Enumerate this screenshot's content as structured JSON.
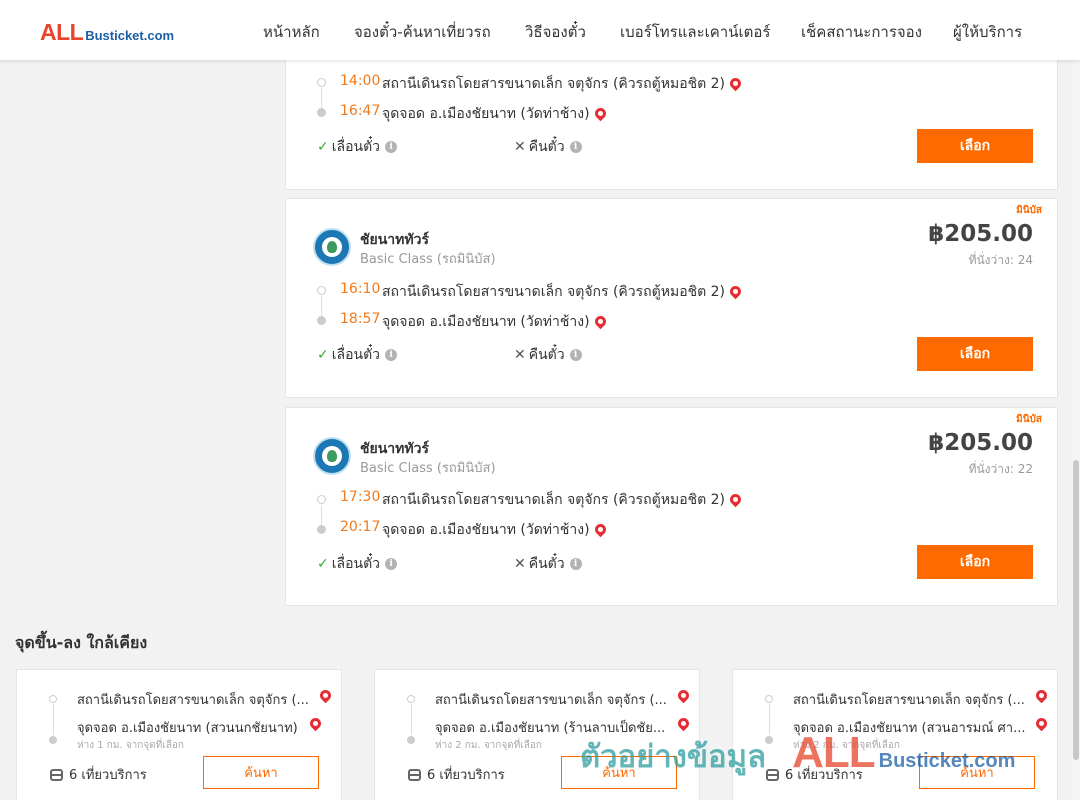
{
  "header": {
    "logo_all": "ALL",
    "logo_rest": "Busticket.com",
    "nav": [
      {
        "label": "หน้าหลัก"
      },
      {
        "label": "จองตั๋ว-ค้นหาเที่ยวรถ"
      },
      {
        "label": "วิธีจองตั๋ว"
      },
      {
        "label": "เบอร์โทรและเคาน์เตอร์"
      },
      {
        "label": "เช็คสถานะการจอง"
      },
      {
        "label": "ผู้ให้บริการ"
      }
    ]
  },
  "trips": [
    {
      "depart_time": "14:00",
      "depart_stop": "สถานีเดินรถโดยสารขนาดเล็ก จตุจักร (คิวรถตู้หมอชิต 2)",
      "arrive_time": "16:47",
      "arrive_stop": "จุดจอด อ.เมืองชัยนาท (วัดท่าช้าง)",
      "change_label": "เลื่อนตั๋ว",
      "refund_label": "คืนตั๋ว",
      "select_label": "เลือก"
    },
    {
      "badge": "มินิบัส",
      "operator": "ชัยนาททัวร์",
      "bus_class": "Basic Class (รถมินิบัส)",
      "price": "฿205.00",
      "seats": "ที่นั่งว่าง: 24",
      "depart_time": "16:10",
      "depart_stop": "สถานีเดินรถโดยสารขนาดเล็ก จตุจักร (คิวรถตู้หมอชิต 2)",
      "arrive_time": "18:57",
      "arrive_stop": "จุดจอด อ.เมืองชัยนาท (วัดท่าช้าง)",
      "change_label": "เลื่อนตั๋ว",
      "refund_label": "คืนตั๋ว",
      "select_label": "เลือก"
    },
    {
      "badge": "มินิบัส",
      "operator": "ชัยนาททัวร์",
      "bus_class": "Basic Class (รถมินิบัส)",
      "price": "฿205.00",
      "seats": "ที่นั่งว่าง: 22",
      "depart_time": "17:30",
      "depart_stop": "สถานีเดินรถโดยสารขนาดเล็ก จตุจักร (คิวรถตู้หมอชิต 2)",
      "arrive_time": "20:17",
      "arrive_stop": "จุดจอด อ.เมืองชัยนาท (วัดท่าช้าง)",
      "change_label": "เลื่อนตั๋ว",
      "refund_label": "คืนตั๋ว",
      "select_label": "เลือก"
    }
  ],
  "nearby": {
    "title": "จุดขึ้น-ลง ใกล้เคียง",
    "items": [
      {
        "from": "สถานีเดินรถโดยสารขนาดเล็ก จตุจักร (...",
        "to": "จุดจอด อ.เมืองชัยนาท (สวนนกชัยนาท)",
        "distance": "ห่าง 1 กม. จากจุดที่เลือก",
        "trips": "6 เที่ยวบริการ",
        "search_label": "ค้นหา"
      },
      {
        "from": "สถานีเดินรถโดยสารขนาดเล็ก จตุจักร (...",
        "to": "จุดจอด อ.เมืองชัยนาท (ร้านลาบเป็ดชัย...",
        "distance": "ห่าง 2 กม. จากจุดที่เลือก",
        "trips": "6 เที่ยวบริการ",
        "search_label": "ค้นหา"
      },
      {
        "from": "สถานีเดินรถโดยสารขนาดเล็ก จตุจักร (...",
        "to": "จุดจอด อ.เมืองชัยนาท (สวนอารมณ์ ศา...",
        "distance": "ห่าง 2 กม. จากจุดที่เลือก",
        "trips": "6 เที่ยวบริการ",
        "search_label": "ค้นหา"
      }
    ]
  },
  "watermark": {
    "text": "ตัวอย่างข้อมูล",
    "logo_all": "ALL",
    "logo_rest": "Busticket.com"
  },
  "colors": {
    "accent": "#ff6a00",
    "time": "#f07a1c",
    "pin": "#e52e34",
    "check": "#3aaa35"
  }
}
